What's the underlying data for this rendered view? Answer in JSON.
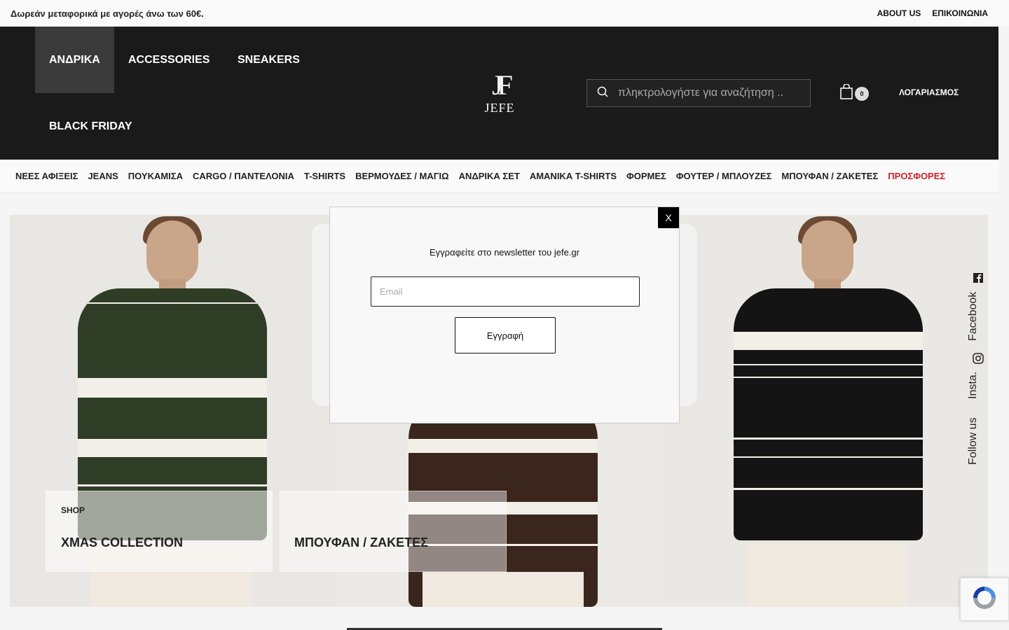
{
  "topbar": {
    "promo": "Δωρεάν μεταφορικά με αγορές άνω των 60€.",
    "links": [
      "ABOUT US",
      "ΕΠΙΚΟΙΝΩΝΙΑ"
    ]
  },
  "header": {
    "nav": [
      "ΑΝΔΡΙΚΑ",
      "ACCESSORIES",
      "SNEAKERS",
      "BLACK FRIDAY"
    ],
    "logo_mark": "JF",
    "logo_name": "JEFE",
    "search_placeholder": "πληκτρολογήστε για αναζήτηση ..",
    "cart_count": "0",
    "account": "ΛΟΓΑΡΙΑΣΜΟΣ"
  },
  "categories": [
    "ΝΕΕΣ ΑΦΙΞΕΙΣ",
    "JEANS",
    "ΠΟΥΚΑΜΙΣΑ",
    "CARGO / ΠΑΝΤΕΛΟΝΙΑ",
    "T-SHIRTS",
    "ΒΕΡΜΟΥΔΕΣ / ΜΑΓΙΩ",
    "ΑΝΔΡΙΚΑ ΣΕΤ",
    "ΑΜΑΝΙΚΑ T-SHIRTS",
    "ΦΟΡΜΕΣ",
    "ΦΟΥΤΕΡ / ΜΠΛΟΥΖΕΣ",
    "ΜΠΟΥΦΑΝ / ΖΑΚΕΤΕΣ",
    "ΠΡΟΣΦΟΡΕΣ"
  ],
  "hero": {
    "cta1_small": "SHOP",
    "cta1_big": "XMAS COLLECTION",
    "cta2_big": "ΜΠΟΥΦΑΝ / ΖΑΚΕΤΕΣ"
  },
  "follow": {
    "facebook": "Facebook",
    "insta": "Insta.",
    "follow_us": "Follow us"
  },
  "modal": {
    "close": "X",
    "title": "Εγγραφείτε στο newsletter του jefe.gr",
    "email_placeholder": "Email",
    "submit": "Εγγραφή"
  },
  "colors": {
    "header_bg": "#1a1a1a",
    "sale": "#d0202a",
    "sweater_green": "#2f3d26",
    "sweater_brown": "#3a261c",
    "sweater_black": "#141414",
    "stripe": "#f2efe8"
  }
}
